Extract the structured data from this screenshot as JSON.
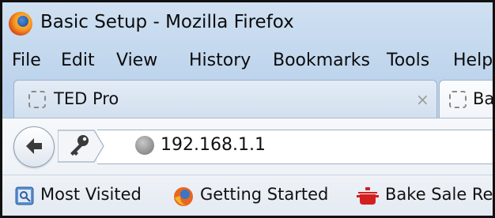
{
  "window": {
    "title": "Basic Setup - Mozilla Firefox"
  },
  "menu": [
    "File",
    "Edit",
    "View",
    "History",
    "Bookmarks",
    "Tools",
    "Help"
  ],
  "tabs": [
    {
      "label": "TED Pro",
      "close": "×"
    },
    {
      "label": "Ba"
    }
  ],
  "navigation": {
    "url": "192.168.1.1"
  },
  "bookmarks": [
    {
      "label": "Most Visited",
      "icon": "most-visited-icon"
    },
    {
      "label": "Getting Started",
      "icon": "firefox-icon"
    },
    {
      "label": "Bake Sale Re",
      "icon": "pot-icon"
    }
  ]
}
